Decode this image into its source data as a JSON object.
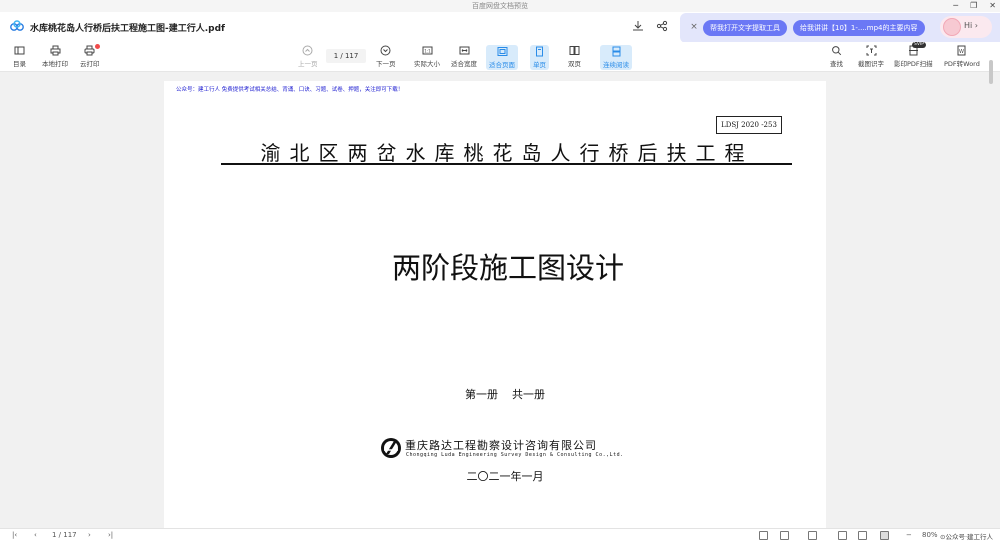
{
  "window": {
    "title": "百度网盘文档预览",
    "controls": [
      "─",
      "❐",
      "✕"
    ]
  },
  "file": {
    "name": "水库桃花岛人行桥后扶工程施工图-建工行人.pdf"
  },
  "ai": {
    "close": "×",
    "pill1": "帮我打开文字提取工具",
    "pill2": "给我讲讲【10】1-....mp4的主要内容",
    "bot_label": "Hi ›"
  },
  "toolbar": {
    "catalog": "目录",
    "local_print": "本地打印",
    "cloud_print": "云打印",
    "prev": "上一页",
    "page": "1 / 117",
    "next": "下一页",
    "actual_size": "实际大小",
    "fit_width": "适合宽度",
    "fit_page": "适合页面",
    "single": "单页",
    "double": "双页",
    "continuous": "连续阅读",
    "find": "查找",
    "ocr": "截图识字",
    "scan_print": "影印PDF扫描",
    "to_word": "PDF转Word",
    "new_badge": "SVIP"
  },
  "document": {
    "watermark_top": "公众号：建工行人 免费提供考试相关总结、背诵、口诀、习题、试卷、押题，关注即可下载！",
    "code": "LDSJ 2020 -253",
    "project": "渝北区两岔水库桃花岛人行桥后扶工程",
    "title": "两阶段施工图设计",
    "volume": "第一册    共一册",
    "company_cn": "重庆路达工程勘察设计咨询有限公司",
    "company_en": "Chongqing Luda Engineering Survey Design & Consulting Co.,Ltd.",
    "date": "二〇二一年一月"
  },
  "status": {
    "page": "1 / 117",
    "zoom": "80%",
    "brand": "⊙公众号·建工行人"
  }
}
